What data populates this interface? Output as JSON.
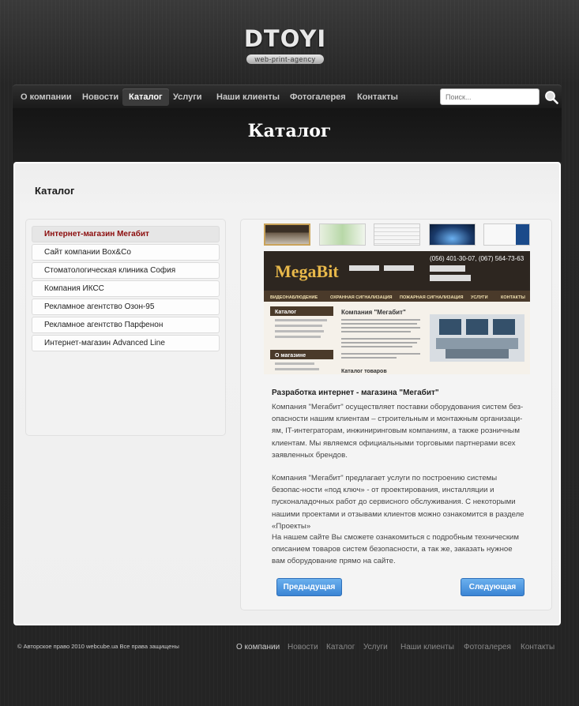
{
  "logo": {
    "main": "DTOYI",
    "sub": "web-print-agency"
  },
  "nav": {
    "items": [
      "О компании",
      "Новости",
      "Каталог",
      "Услуги",
      "Наши клиенты",
      "Фотогалерея",
      "Контакты"
    ],
    "active_index": 2,
    "search_placeholder": "Поиск..."
  },
  "page_title": "Каталог",
  "section_title": "Каталог",
  "list": {
    "items": [
      "Интернет-магазин Мегабит",
      "Сайт компании Box&Co",
      "Стоматологическая клиника София",
      "Компания ИКСС",
      "Рекламное агентство Озон-95",
      "Рекламное агентство Парфенон",
      "Интернет-магазин Advanced Line"
    ],
    "active_index": 0
  },
  "preview": {
    "brand": "MegaBit",
    "phone": "(056) 401-30-07, (067) 564-73-63",
    "heading": "Компания \"Мегабит\"",
    "catalog_label": "Каталог",
    "about_label": "О магазине",
    "goods_label": "Каталог товаров",
    "menu": [
      "ВИДЕОНАБЛЮДЕНИЕ",
      "ОХРАННАЯ СИГНАЛИЗАЦИЯ",
      "ПОЖАРНАЯ СИГНАЛИЗАЦИЯ",
      "УСЛУГИ",
      "КОНТАКТЫ"
    ]
  },
  "description": {
    "title": "Разработка интернет - магазина  \"Мегабит\"",
    "p1": "Компания \"Мегабит\" осуществляет поставки оборудования систем без-опасности нашим клиентам – строительным и монтажным организаци-ям, IT-интеграторам, инжиниринговым компаниям, а также розничным клиентам. Мы являемся официальными торговыми партнерами всех заявленных брендов.",
    "p2": "Компания \"Мегабит\" предлагает услуги по построению системы безопас-ности «под ключ» - от проектирования, инсталляции и пусконаладочных работ до сервисного обслуживания. С некоторыми нашими проектами и отзывами клиентов можно ознакомится в разделе «Проекты»",
    "p3": "На нашем сайте Вы сможете ознакомиться с подробным техническим описанием товаров систем безопасности, а так же, заказать нужное вам оборудование прямо на сайте."
  },
  "buttons": {
    "prev": "Предыдущая",
    "next": "Следующая"
  },
  "footer": {
    "copyright": "© Авторское право 2010 webcube.ua   Все права защищены",
    "links": [
      "О компании",
      "Новости",
      "Каталог",
      "Услуги",
      "Наши клиенты",
      "Фотогалерея",
      "Контакты"
    ]
  },
  "colors": {
    "accent_red": "#8b0b0b",
    "button_blue": "#3a84d4",
    "thumb_active": "#c9a35a"
  }
}
